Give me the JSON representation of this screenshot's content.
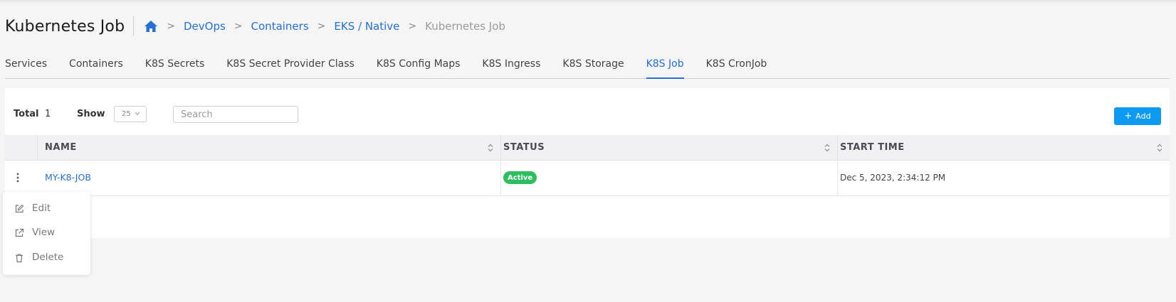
{
  "header": {
    "title": "Kubernetes Job",
    "breadcrumb": {
      "home_icon": "home-icon",
      "items": [
        "DevOps",
        "Containers",
        "EKS / Native"
      ],
      "current": "Kubernetes Job",
      "separator": ">"
    }
  },
  "tabs": [
    {
      "label": "Services",
      "active": false
    },
    {
      "label": "Containers",
      "active": false
    },
    {
      "label": "K8S Secrets",
      "active": false
    },
    {
      "label": "K8S Secret Provider Class",
      "active": false
    },
    {
      "label": "K8S Config Maps",
      "active": false
    },
    {
      "label": "K8S Ingress",
      "active": false
    },
    {
      "label": "K8S Storage",
      "active": false
    },
    {
      "label": "K8S Job",
      "active": true
    },
    {
      "label": "K8S CronJob",
      "active": false
    }
  ],
  "toolbar": {
    "total_label": "Total",
    "total_value": "1",
    "show_label": "Show",
    "show_value": "25",
    "search_placeholder": "Search",
    "add_label": "Add",
    "add_icon": "plus-icon"
  },
  "table": {
    "columns": [
      "NAME",
      "STATUS",
      "START TIME"
    ],
    "rows": [
      {
        "name": "MY-K8-JOB",
        "status": "Active",
        "start_time": "Dec 5, 2023, 2:34:12 PM"
      }
    ]
  },
  "row_menu": {
    "items": [
      {
        "label": "Edit",
        "icon": "edit-icon"
      },
      {
        "label": "View",
        "icon": "external-link-icon"
      },
      {
        "label": "Delete",
        "icon": "trash-icon"
      }
    ]
  },
  "colors": {
    "link": "#2470d6",
    "active_badge": "#2ebd5f",
    "add_button": "#0d9af0",
    "background": "#f5f5f6"
  }
}
